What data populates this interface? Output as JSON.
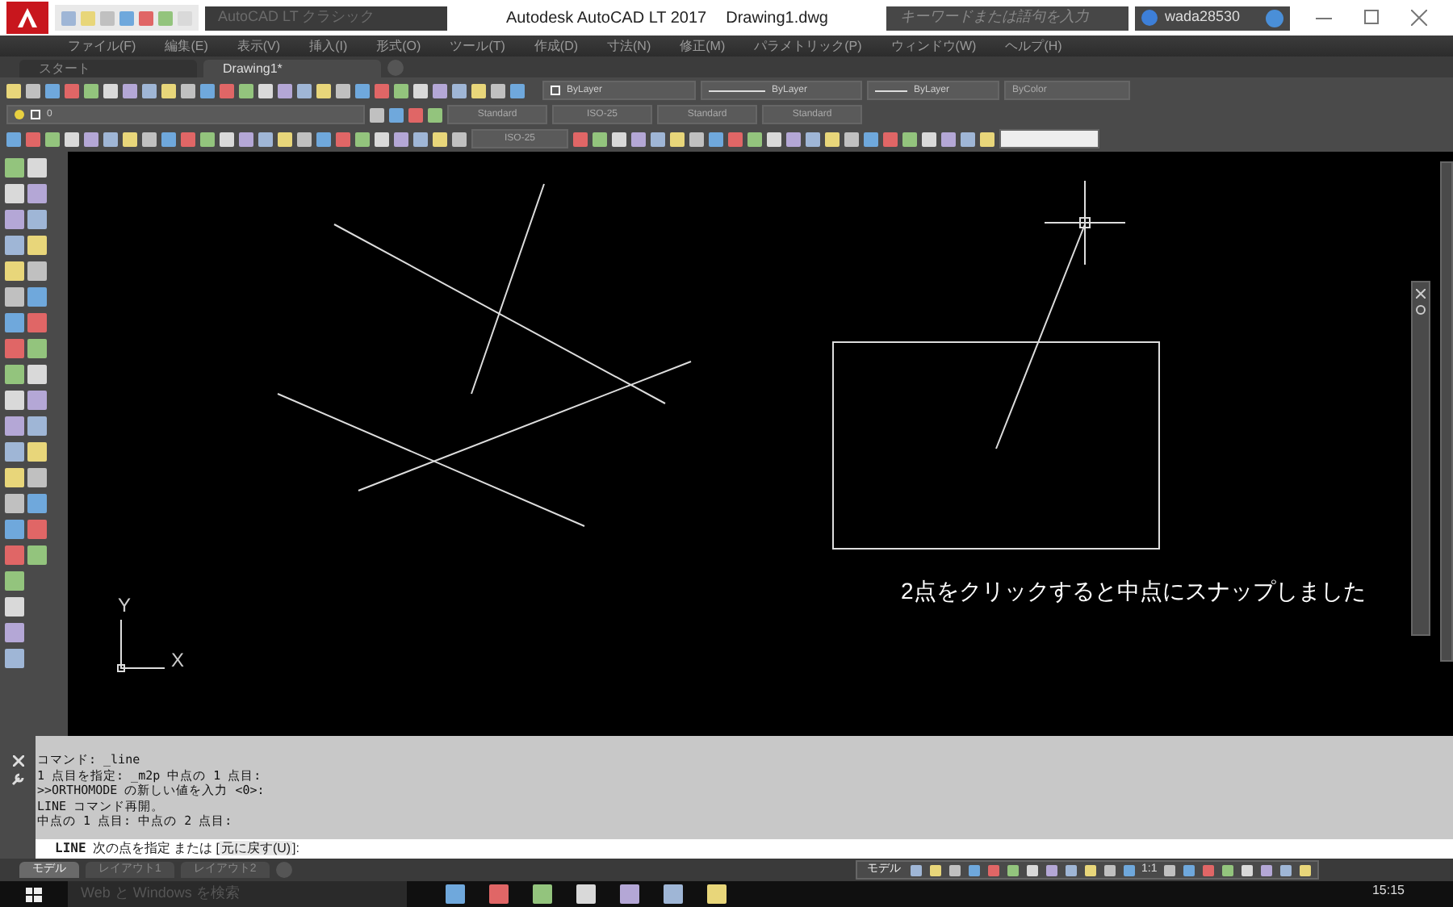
{
  "title_bar": {
    "workspace": "AutoCAD LT クラシック",
    "title": "Autodesk AutoCAD LT 2017",
    "file": "Drawing1.dwg",
    "search": {
      "placeholder": "キーワードまたは語句を入力"
    },
    "user": "wada28530"
  },
  "menu": [
    "ファイル(F)",
    "編集(E)",
    "表示(V)",
    "挿入(I)",
    "形式(O)",
    "ツール(T)",
    "作成(D)",
    "寸法(N)",
    "修正(M)",
    "パラメトリック(P)",
    "ウィンドウ(W)",
    "ヘルプ(H)"
  ],
  "tabs": [
    {
      "label": "スタート",
      "selected": false
    },
    {
      "label": "Drawing1*",
      "selected": true
    }
  ],
  "properties": {
    "color_control": "ByLayer",
    "linetype": "ByLayer",
    "lineweight": "ByLayer",
    "plotstyle": "ByColor"
  },
  "layer": "0",
  "styles": {
    "text": "Standard",
    "dim": "ISO-25",
    "table": "Standard",
    "multileader": "Standard"
  },
  "dim_style": "ISO-25",
  "canvas": {
    "annotation": "2点をクリックすると中点にスナップしました",
    "axis_x": "X",
    "axis_y": "Y"
  },
  "command_history": [
    "コマンド: _line",
    "1 点目を指定: _m2p 中点の 1 点目:",
    ">>ORTHOMODE の新しい値を入力 <0>:",
    "LINE コマンド再開。",
    "中点の 1 点目: 中点の 2 点目:"
  ],
  "prompt": {
    "command": "LINE",
    "text": "次の点を指定 または [",
    "option": "元に戻す(U)",
    "end": "]:"
  },
  "layout_tabs": [
    {
      "label": "モデル",
      "selected": true
    },
    {
      "label": "レイアウト1",
      "selected": false
    },
    {
      "label": "レイアウト2",
      "selected": false
    }
  ],
  "status_bar": {
    "space": "モデル",
    "scale": "1:1"
  },
  "taskbar": {
    "search": "Web と Windows を検索",
    "time": "15:15"
  }
}
